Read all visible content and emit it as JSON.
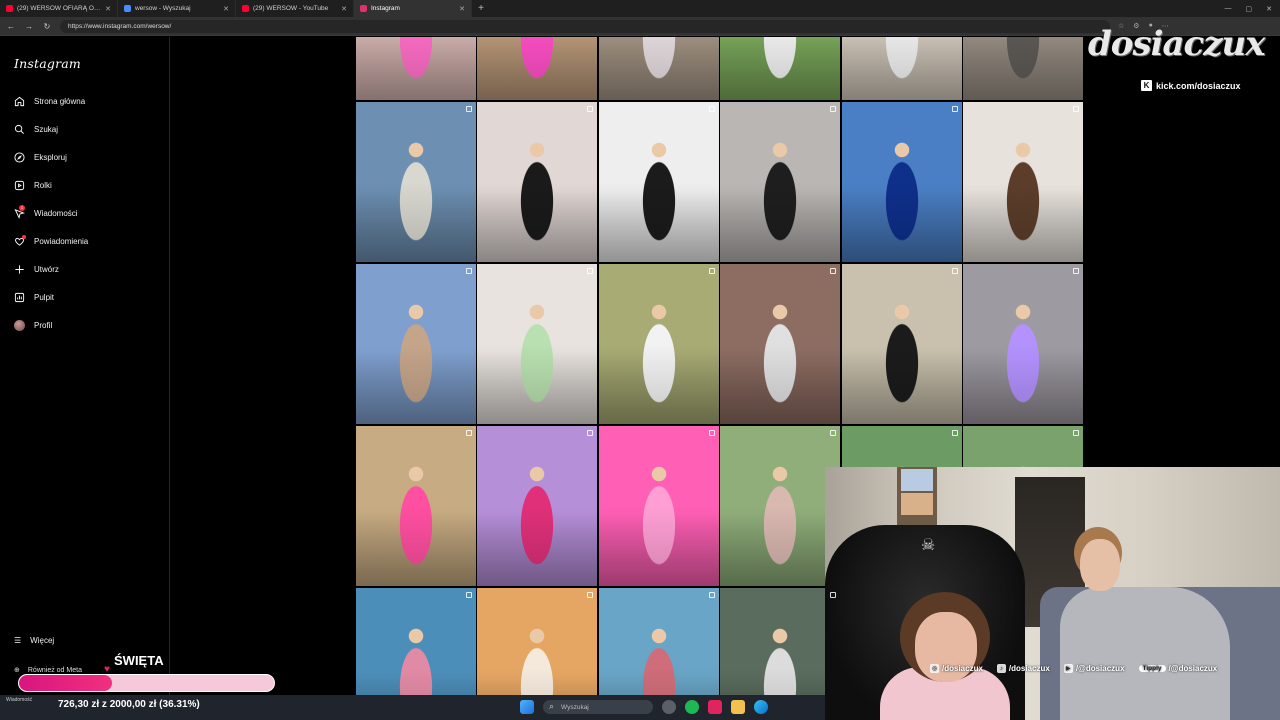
{
  "browser": {
    "tabs": [
      {
        "title": "(29) WERSOW OFIARĄ OKRUTNE",
        "color": "#ff0033"
      },
      {
        "title": "wersow - Wyszukaj",
        "color": "#4a8cff"
      },
      {
        "title": "(29) WERSOW - YouTube",
        "color": "#ff0033"
      },
      {
        "title": "Instagram",
        "color": "#e1306c"
      }
    ],
    "url": "https://www.instagram.com/wersow/"
  },
  "sidebar": {
    "logo": "Instagram",
    "items": [
      {
        "label": "Strona główna",
        "icon": "home-icon"
      },
      {
        "label": "Szukaj",
        "icon": "search-icon"
      },
      {
        "label": "Eksploruj",
        "icon": "compass-icon"
      },
      {
        "label": "Rolki",
        "icon": "reels-icon"
      },
      {
        "label": "Wiadomości",
        "icon": "messenger-icon",
        "badge": "1"
      },
      {
        "label": "Powiadomienia",
        "icon": "heart-icon"
      },
      {
        "label": "Utwórz",
        "icon": "plus-icon"
      },
      {
        "label": "Pulpit",
        "icon": "dashboard-icon"
      },
      {
        "label": "Profil",
        "icon": "avatar"
      }
    ],
    "more": "Więcej",
    "meta": "Również od Meta"
  },
  "grid": {
    "colors": [
      [
        "#d9b8b4",
        "#c29f7e",
        "#a89988",
        "#7fae5e",
        "#d8cfc1",
        "#9d9388"
      ],
      [
        "#6d8fb2",
        "#e1d7d4",
        "#eeeeee",
        "#b9b6b3",
        "#4a7fc5",
        "#e7e2dc"
      ],
      [
        "#7fa0cf",
        "#e8e3de",
        "#a8ab74",
        "#8d6d62",
        "#c9c1ad",
        "#9e9aa2"
      ],
      [
        "#c7ab82",
        "#b68fd9",
        "#ff5fb4",
        "#8fae7a",
        "#6c9c63",
        "#7aa26d"
      ],
      [
        "#4c8eba",
        "#e5a663",
        "#69a5c6",
        "#596c5d",
        "#000000",
        "#000000"
      ]
    ],
    "accents": [
      [
        "#ff6ec7",
        "#ff4fc6",
        "#e7dde0",
        "#f2f2f2",
        "#f0f0f0",
        "#5d5a56"
      ],
      [
        "#d8d8d0",
        "#1a1a1a",
        "#1b1b1b",
        "#1e1e1e",
        "#0e2f8a",
        "#5b3d2a"
      ],
      [
        "#c5a58a",
        "#b9e0b0",
        "#f2f2f2",
        "#e0e0e0",
        "#1b1b1b",
        "#b392ff"
      ],
      [
        "#ff4fa0",
        "#e0307a",
        "#ff9fd4",
        "#d9b8b0",
        "#3c6b36",
        "#4d7d48"
      ],
      [
        "#e18aa5",
        "#f5e9dc",
        "#cf6d7a",
        "#dcdcdc",
        "#000000",
        "#000000"
      ]
    ]
  },
  "overlay": {
    "brand": "dosiaczux",
    "kick": "kick.com/dosiaczux",
    "socials": [
      "/dosiaczux",
      "/dosiaczux",
      "/@dosiaczux",
      "/@dosiaczux"
    ],
    "tipply": "Tipply"
  },
  "goal": {
    "title": "ŚWIĘTA",
    "amount": "726,30 zł z 2000,00 zł (36.31%)",
    "percent": 36.31
  },
  "taskbar": {
    "search": "Wyszukaj",
    "notification": "Wiadomość"
  }
}
